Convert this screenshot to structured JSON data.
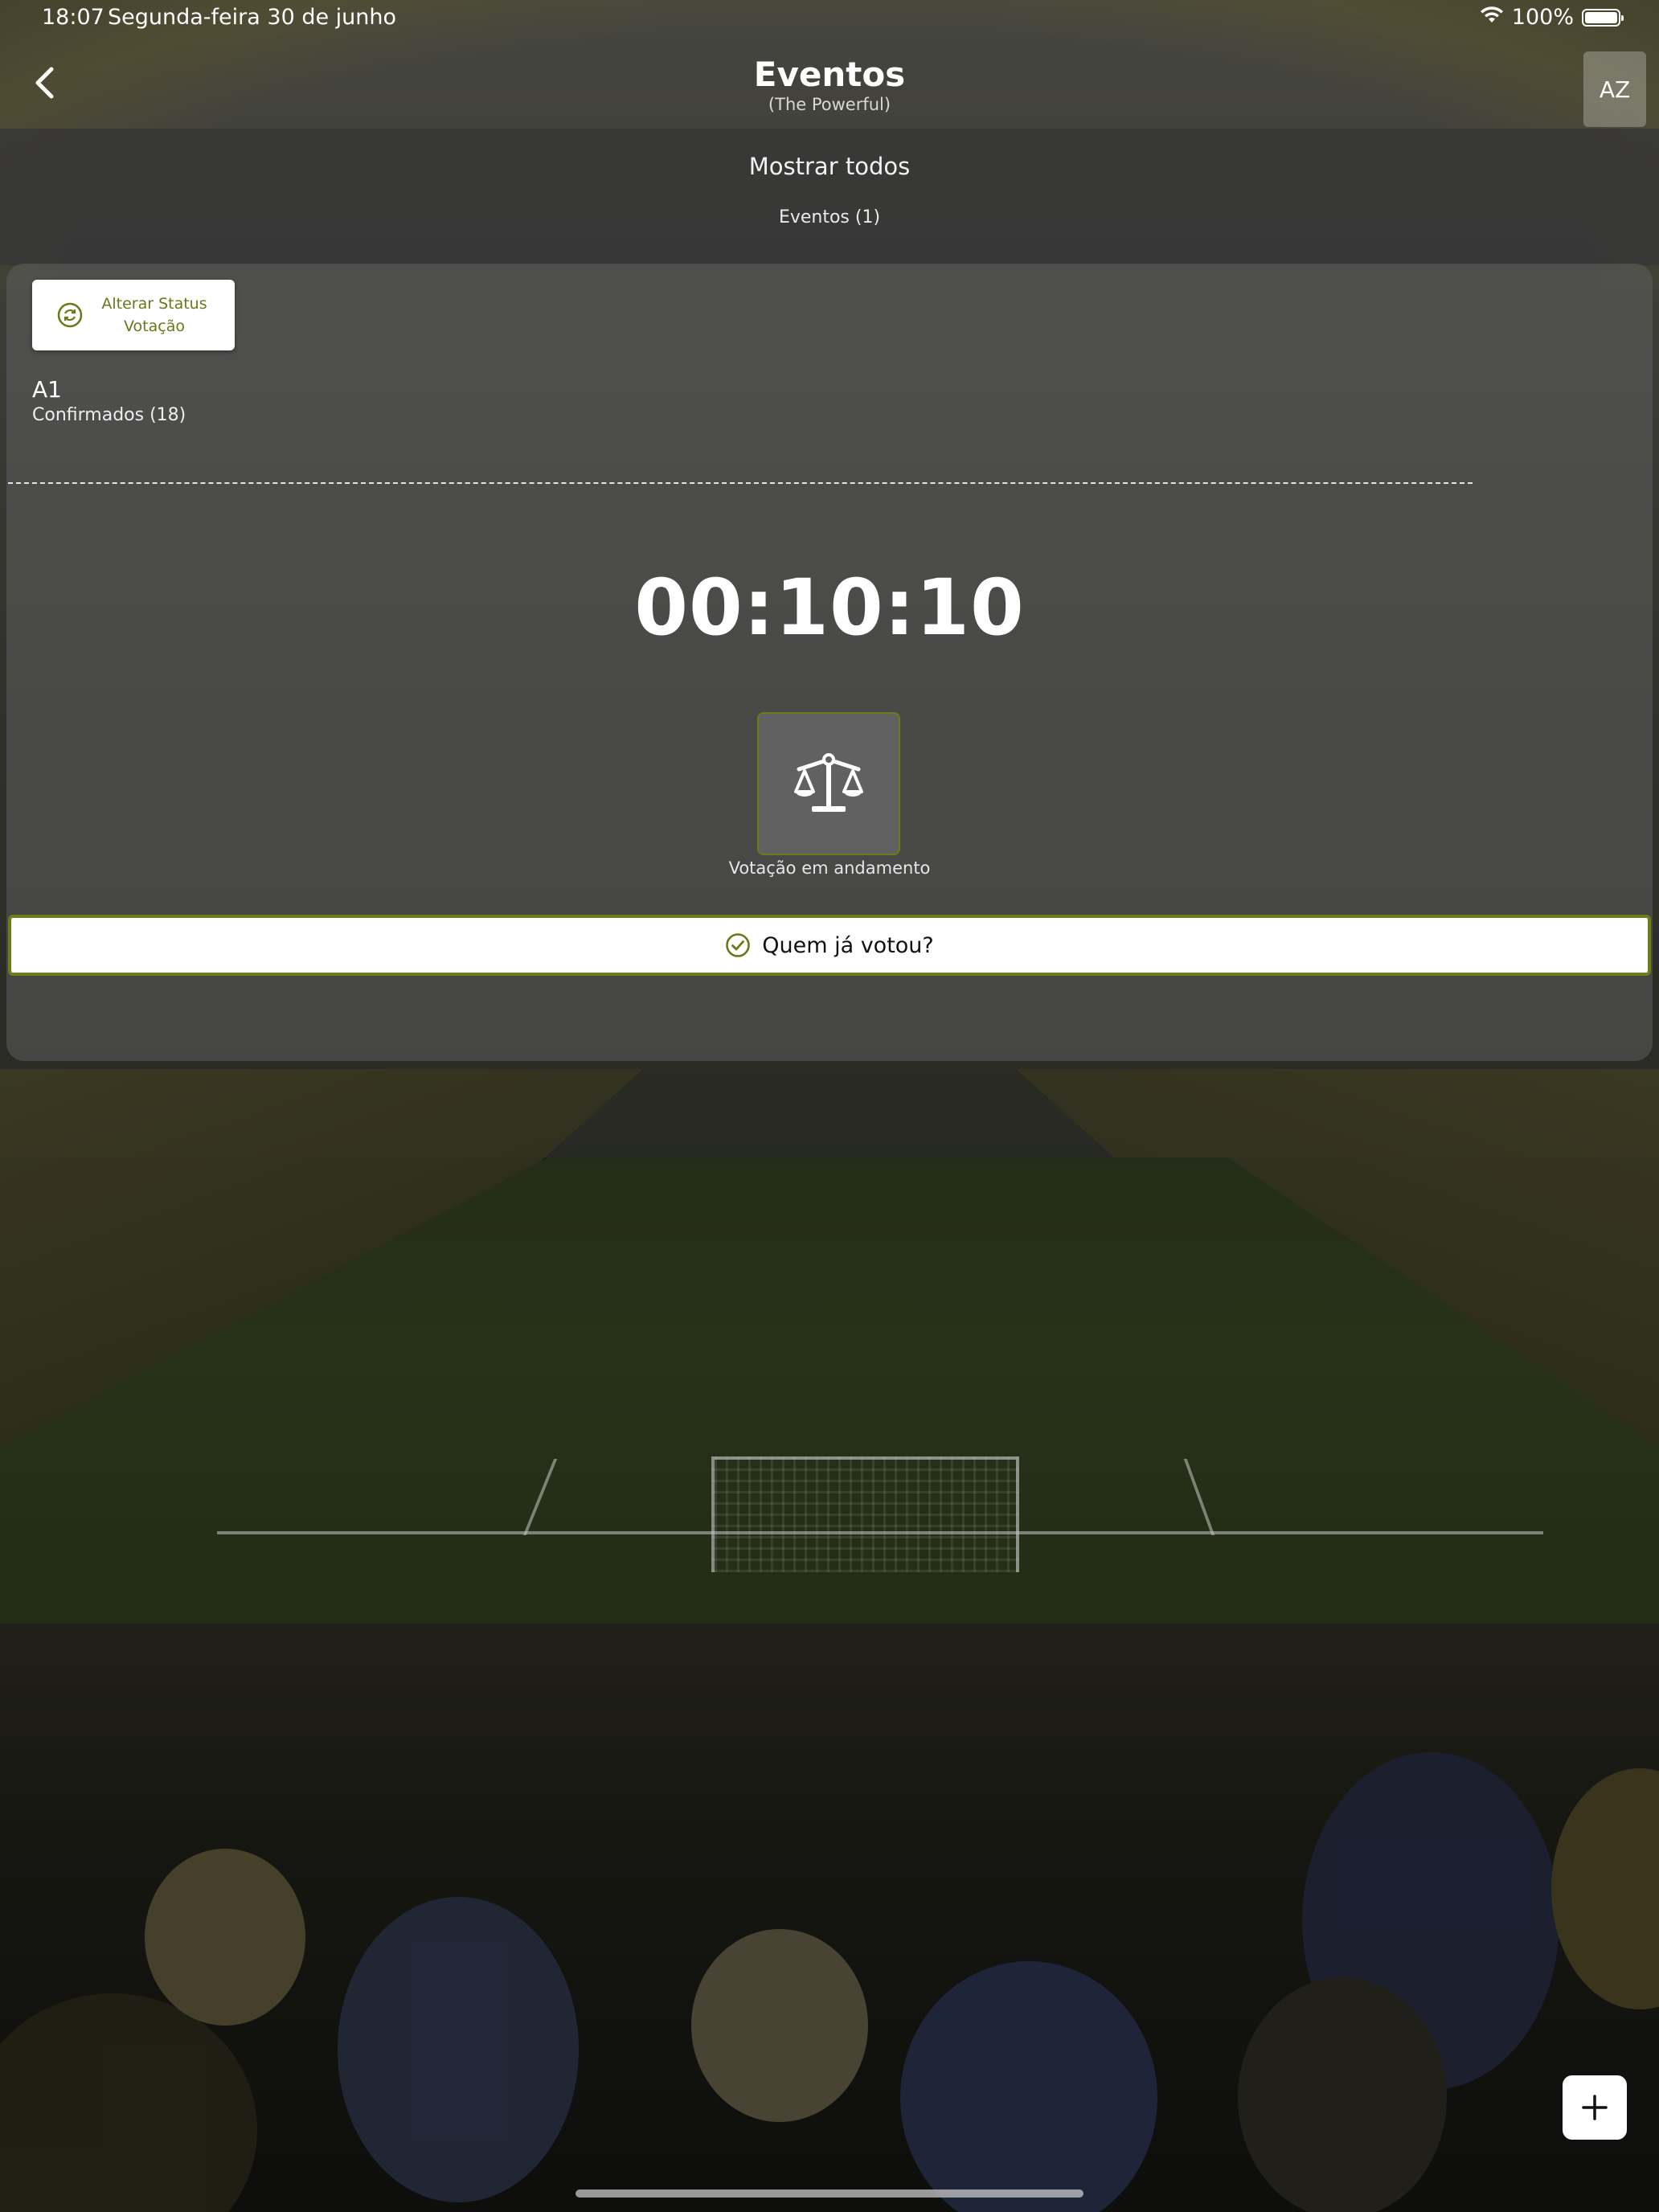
{
  "status_bar": {
    "time": "18:07",
    "date": "Segunda-feira 30 de junho",
    "battery": "100%"
  },
  "nav": {
    "back_icon": "chevron-left-icon",
    "title": "Eventos",
    "subtitle": "(The Powerful)",
    "sort_label": "AZ"
  },
  "filter": {
    "show_all": "Mostrar todos",
    "events_count": "Eventos (1)"
  },
  "event": {
    "status_button": {
      "line1": "Alterar Status",
      "line2": "Votação",
      "icon": "refresh-circle-icon"
    },
    "name": "A1",
    "confirmed": "Confirmados (18)",
    "timer": "00:10:10",
    "voting_icon": "scale-icon",
    "voting_status": "Votação em andamento",
    "who_voted": {
      "label": "Quem já votou?",
      "icon": "check-circle-icon"
    }
  },
  "fab": {
    "icon": "plus-icon"
  },
  "colors": {
    "accent": "#6b7d17",
    "accent_text": "#667a1a",
    "panel": "#373737"
  }
}
